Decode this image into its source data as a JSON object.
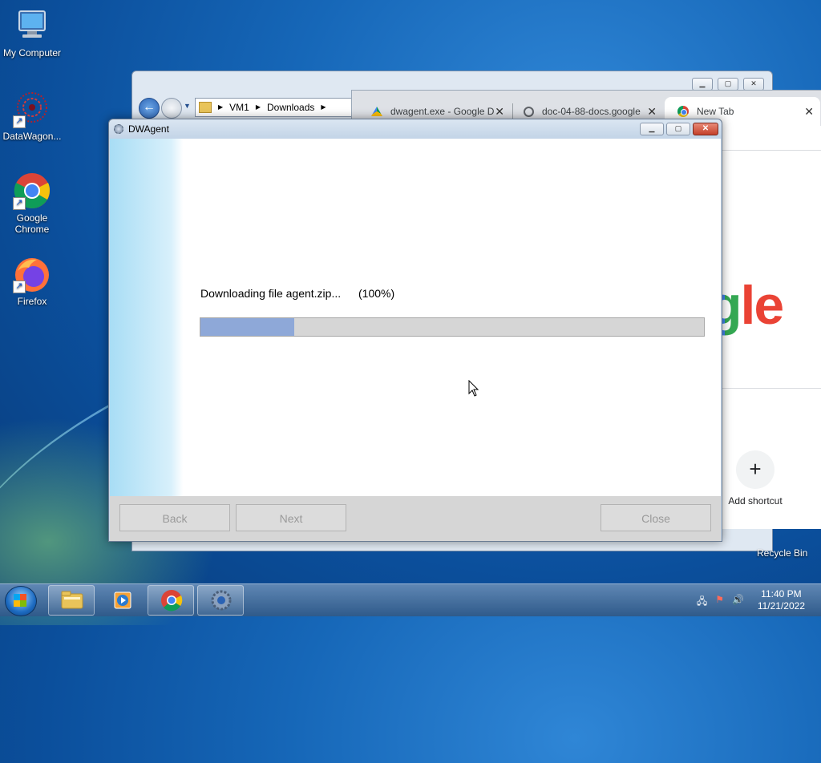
{
  "desktop": {
    "icons": [
      {
        "label": "My Computer"
      },
      {
        "label": "DataWagon..."
      },
      {
        "label": "Google Chrome"
      },
      {
        "label": "Firefox"
      }
    ],
    "recycle_bin_label": "Recycle Bin"
  },
  "explorer": {
    "breadcrumb": [
      "VM1",
      "Downloads"
    ]
  },
  "chrome": {
    "tabs": [
      {
        "title": "dwagent.exe - Google D"
      },
      {
        "title": "doc-04-88-docs.google"
      },
      {
        "title": "New Tab"
      }
    ],
    "logo_partial": "gle",
    "add_shortcut_label": "Add shortcut"
  },
  "dialog": {
    "title": "DWAgent",
    "progress_text": "Downloading file agent.zip...",
    "progress_percent_text": "(100%)",
    "progress_fill_fraction": 0.186,
    "buttons": {
      "back": "Back",
      "next": "Next",
      "close": "Close"
    }
  },
  "taskbar": {
    "pinned": [
      "windows-explorer",
      "media-player",
      "google-chrome",
      "dwagent"
    ],
    "clock_time": "11:40 PM",
    "clock_date": "11/21/2022"
  }
}
